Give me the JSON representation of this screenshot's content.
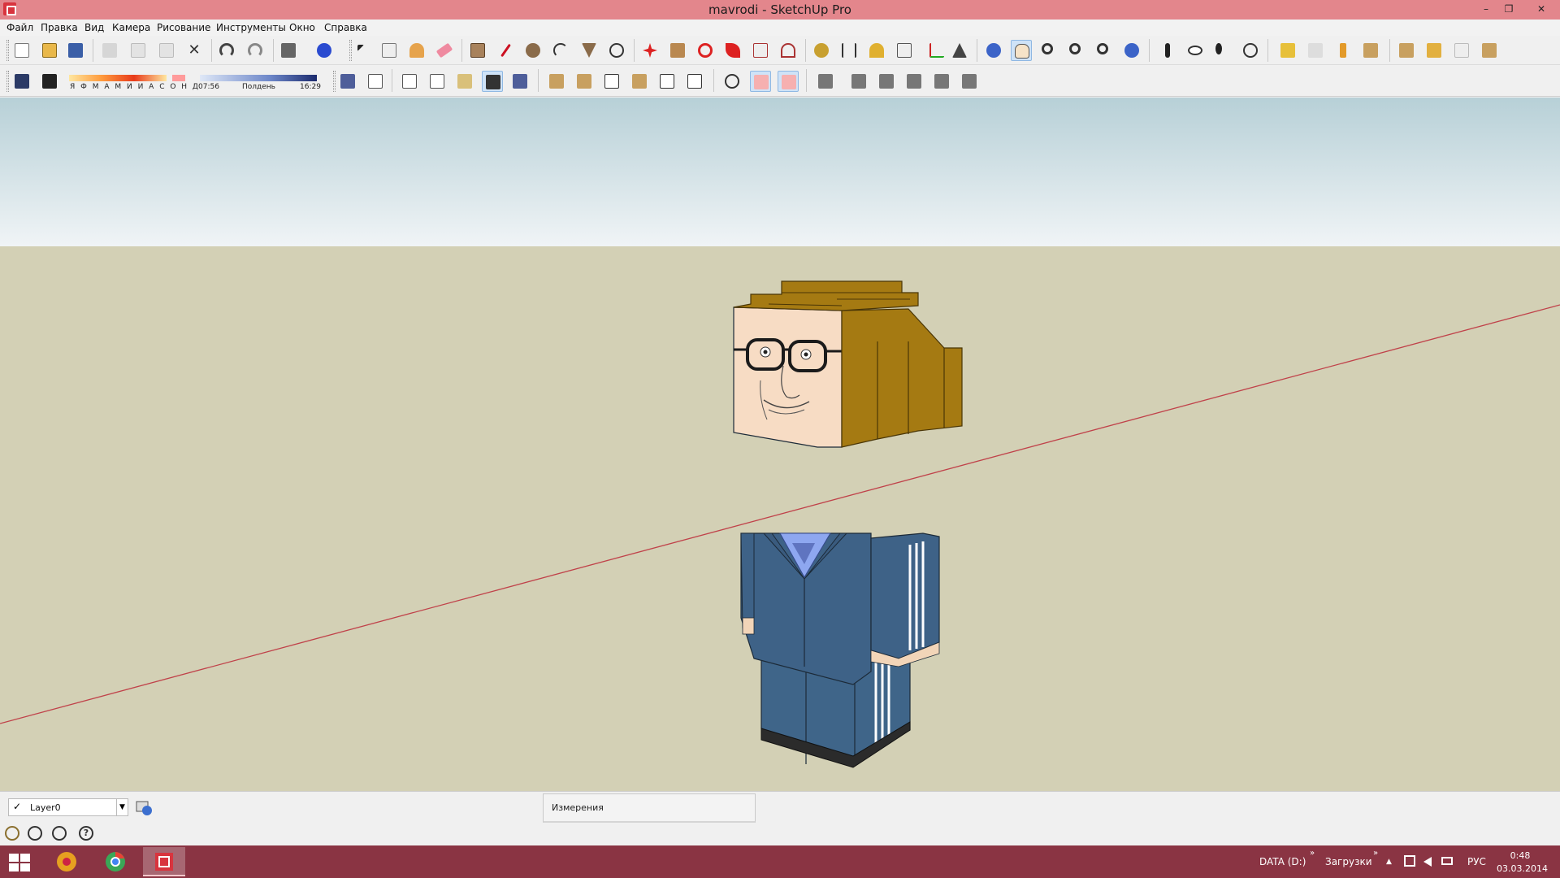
{
  "window": {
    "title": "mavrodi - SketchUp Pro",
    "minimize": "–",
    "restore": "❐",
    "close": "✕"
  },
  "menu": [
    "Файл",
    "Правка",
    "Вид",
    "Камера",
    "Рисование",
    "Инструменты",
    "Окно",
    "Справка"
  ],
  "shadow_toolbar": {
    "months": "Я Ф М А М И И А С О Н Д",
    "time_start": "07:56",
    "time_mid": "Полдень",
    "time_end": "16:29"
  },
  "layers": {
    "current": "Layer0",
    "checkmark": "✓"
  },
  "measurements": {
    "label": "Измерения"
  },
  "status_icons": [
    "?"
  ],
  "taskbar": {
    "drive": "DATA (D:)",
    "downloads": "Загрузки",
    "chevron": "»",
    "language": "РУС",
    "time": "0:48",
    "date": "03.03.2014",
    "tray_up": "▲"
  },
  "colors": {
    "titlebar": "#e3868c",
    "taskbar": "#8a3443",
    "sky": "#b7d0d7",
    "ground": "#d3d0b5",
    "suit": "#3e6287",
    "hair": "#a57a12",
    "skin": "#f7dcc4"
  },
  "icons": [
    "new-icon",
    "open-icon",
    "save-icon",
    "cut-icon",
    "copy-icon",
    "paste-icon",
    "erase-icon",
    "undo-icon",
    "redo-icon",
    "print-icon",
    "model-info-icon",
    "select-icon",
    "make-component-icon",
    "paint-bucket-icon",
    "eraser-icon",
    "rectangle-icon",
    "line-icon",
    "circle-icon",
    "arc-icon",
    "polygon-icon",
    "freehand-icon",
    "move-icon",
    "push-pull-icon",
    "rotate-icon",
    "follow-me-icon",
    "scale-icon",
    "offset-icon",
    "tape-measure-icon",
    "dimension-icon",
    "protractor-icon",
    "text-icon",
    "axes-icon",
    "3d-text-icon",
    "orbit-icon",
    "pan-icon",
    "zoom-icon",
    "zoom-window-icon",
    "zoom-extents-icon",
    "previous-view-icon",
    "position-camera-icon",
    "look-around-icon",
    "walk-icon",
    "section-plane-icon",
    "get-models-icon",
    "share-model-icon",
    "share-component-icon",
    "extension-warehouse-icon",
    "sandbox-icon",
    "photo-texture-icon",
    "add-location-icon",
    "toggle-terrain-icon"
  ]
}
